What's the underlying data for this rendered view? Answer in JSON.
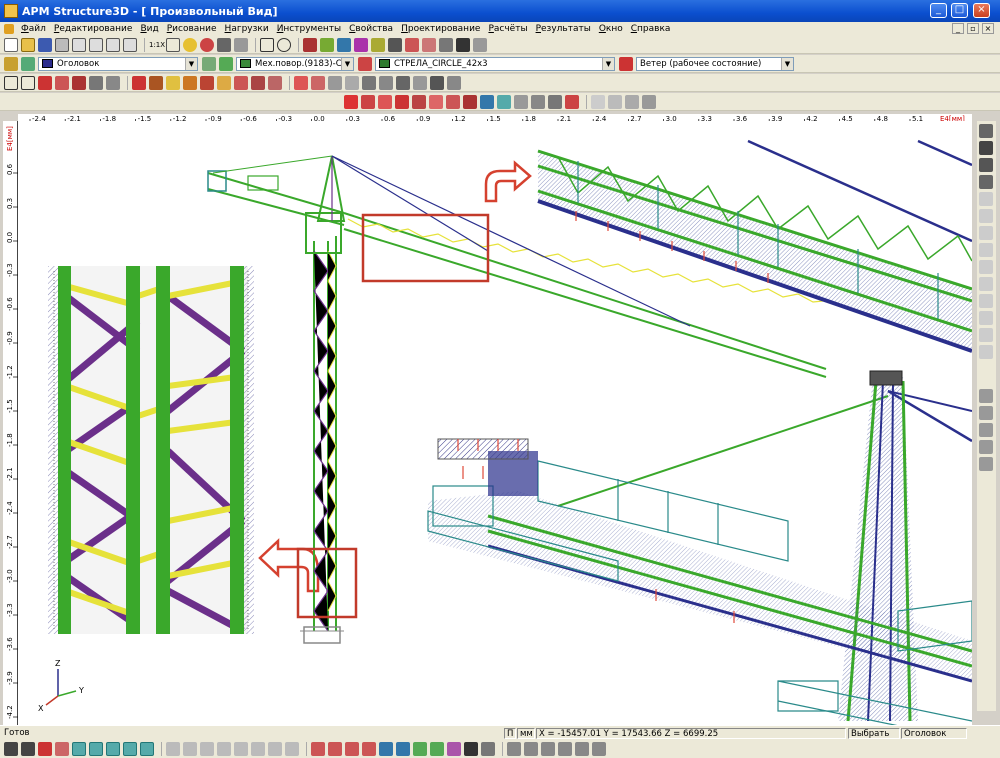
{
  "window": {
    "title": "APM Structure3D - [ Произвольный Вид]"
  },
  "menu": [
    "Файл",
    "Редактирование",
    "Вид",
    "Рисование",
    "Нагрузки",
    "Инструменты",
    "Свойства",
    "Проектирование",
    "Расчёты",
    "Результаты",
    "Окно",
    "Справка"
  ],
  "toolbar2": {
    "scale_label": "1:1X",
    "layer_combo": "Оголовок",
    "section_combo": "Мех.повор.(9183)-C2",
    "element_combo": "СТРЕЛА_CIRCLE_42x3",
    "load_case_combo": "Ветер (рабочее состояние)"
  },
  "rulers": {
    "h_unit": "E4[мм]",
    "v_unit": "E4[мм]",
    "h_ticks": [
      "-2.4",
      "-2.1",
      "-1.8",
      "-1.5",
      "-1.2",
      "-0.9",
      "-0.6",
      "-0.3",
      "0.0",
      "0.3",
      "0.6",
      "0.9",
      "1.2",
      "1.5",
      "1.8",
      "2.1",
      "2.4",
      "2.7",
      "3.0",
      "3.3",
      "3.6",
      "3.9",
      "4.2",
      "4.5",
      "4.8",
      "5.1"
    ],
    "v_ticks": [
      "0.6",
      "0.3",
      "0.0",
      "-0.3",
      "-0.6",
      "-0.9",
      "-1.2",
      "-1.5",
      "-1.8",
      "-2.1",
      "-2.4",
      "-2.7",
      "-3.0",
      "-3.3",
      "-3.6",
      "-3.9",
      "-4.2",
      "-4.5"
    ]
  },
  "axes": {
    "z": "Z",
    "x": "X",
    "y": "Y"
  },
  "status": {
    "ready": "Готов",
    "snap": "П",
    "unit": "мм",
    "coords": "X = -15457.01 Y = 17543.66 Z = 6699.25",
    "mode": "Выбрать",
    "layer": "Оголовок"
  },
  "colors": {
    "title_bar": "#0b4fcf",
    "green": "#3aa82b",
    "purple": "#6b2f8a",
    "yellow": "#e6e23a",
    "blue": "#2a2f8c",
    "highlight_red": "#c23a2a",
    "arrow": "#e04a3a"
  },
  "icons": [
    "new-icon",
    "open-icon",
    "save-icon",
    "print-icon",
    "undo-icon",
    "redo-icon",
    "grid-icon",
    "zoom-in-icon",
    "zoom-out-icon",
    "rotate-icon",
    "select-icon",
    "node-icon",
    "beam-icon",
    "load-icon",
    "support-icon"
  ]
}
